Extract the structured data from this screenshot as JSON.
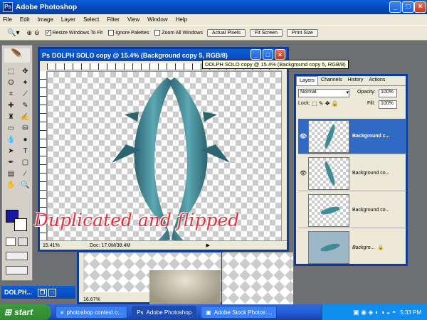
{
  "app": {
    "title": "Adobe Photoshop",
    "logo": "Ps"
  },
  "menu": [
    "File",
    "Edit",
    "Image",
    "Layer",
    "Select",
    "Filter",
    "View",
    "Window",
    "Help"
  ],
  "options": {
    "resize_windows": "Resize Windows To Fit",
    "ignore_palettes": "Ignore Palettes",
    "zoom_all": "Zoom All Windows",
    "actual_pixels": "Actual Pixels",
    "fit_screen": "Fit Screen",
    "print_size": "Print Size"
  },
  "document": {
    "title": "DOLPH SOLO copy @ 15.4% (Background copy 5, RGB/8)",
    "zoom": "15.41%",
    "doc_info": "Doc: 17.0M/38.4M"
  },
  "tooltip": "DOLPH SOLO copy @ 15.4% (Background copy 5, RGB/8)",
  "bg_doc": {
    "zoom": "16.67%",
    "minimized_title": "DOLPH..."
  },
  "overlay_text": "Duplicated and flipped",
  "layers_panel": {
    "tabs": [
      "Layers",
      "Channels",
      "History",
      "Actions"
    ],
    "blend_mode": "Normal",
    "opacity_label": "Opacity:",
    "opacity": "100%",
    "lock_label": "Lock:",
    "fill_label": "Fill:",
    "fill": "100%",
    "layers": [
      {
        "name": "Background c...",
        "active": true,
        "visible": true
      },
      {
        "name": "Background co...",
        "active": false,
        "visible": true
      },
      {
        "name": "Background co...",
        "active": false,
        "visible": false
      },
      {
        "name": "Backgro...",
        "active": false,
        "visible": false
      }
    ]
  },
  "taskbar": {
    "start": "start",
    "tasks": [
      "photoshop contest o...",
      "Adobe Photoshop",
      "Adobe Stock Photos ..."
    ],
    "clock": "5:33 PM"
  },
  "colors": {
    "accent": "#0a3e9e",
    "foreground_swatch": "#1a1aa0",
    "overlay": "#e4303a",
    "dolphin": "#3f8c98"
  }
}
